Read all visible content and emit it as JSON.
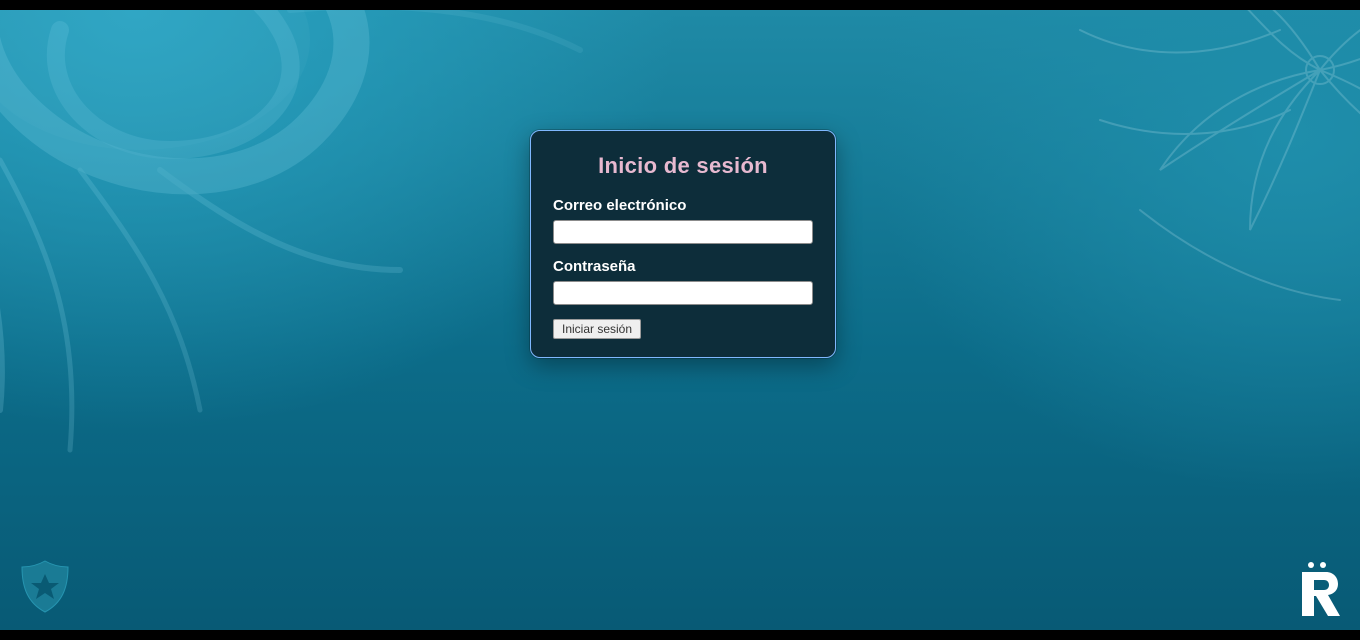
{
  "login": {
    "title": "Inicio de sesión",
    "email_label": "Correo electrónico",
    "email_value": "",
    "password_label": "Contraseña",
    "password_value": "",
    "submit_label": "Iniciar sesión"
  },
  "colors": {
    "card_bg": "#0d2d3a",
    "card_border": "#7fb8ff",
    "title_color": "#e7b9d0",
    "bg_top": "#1f8aa6",
    "bg_bottom": "#085a75"
  }
}
